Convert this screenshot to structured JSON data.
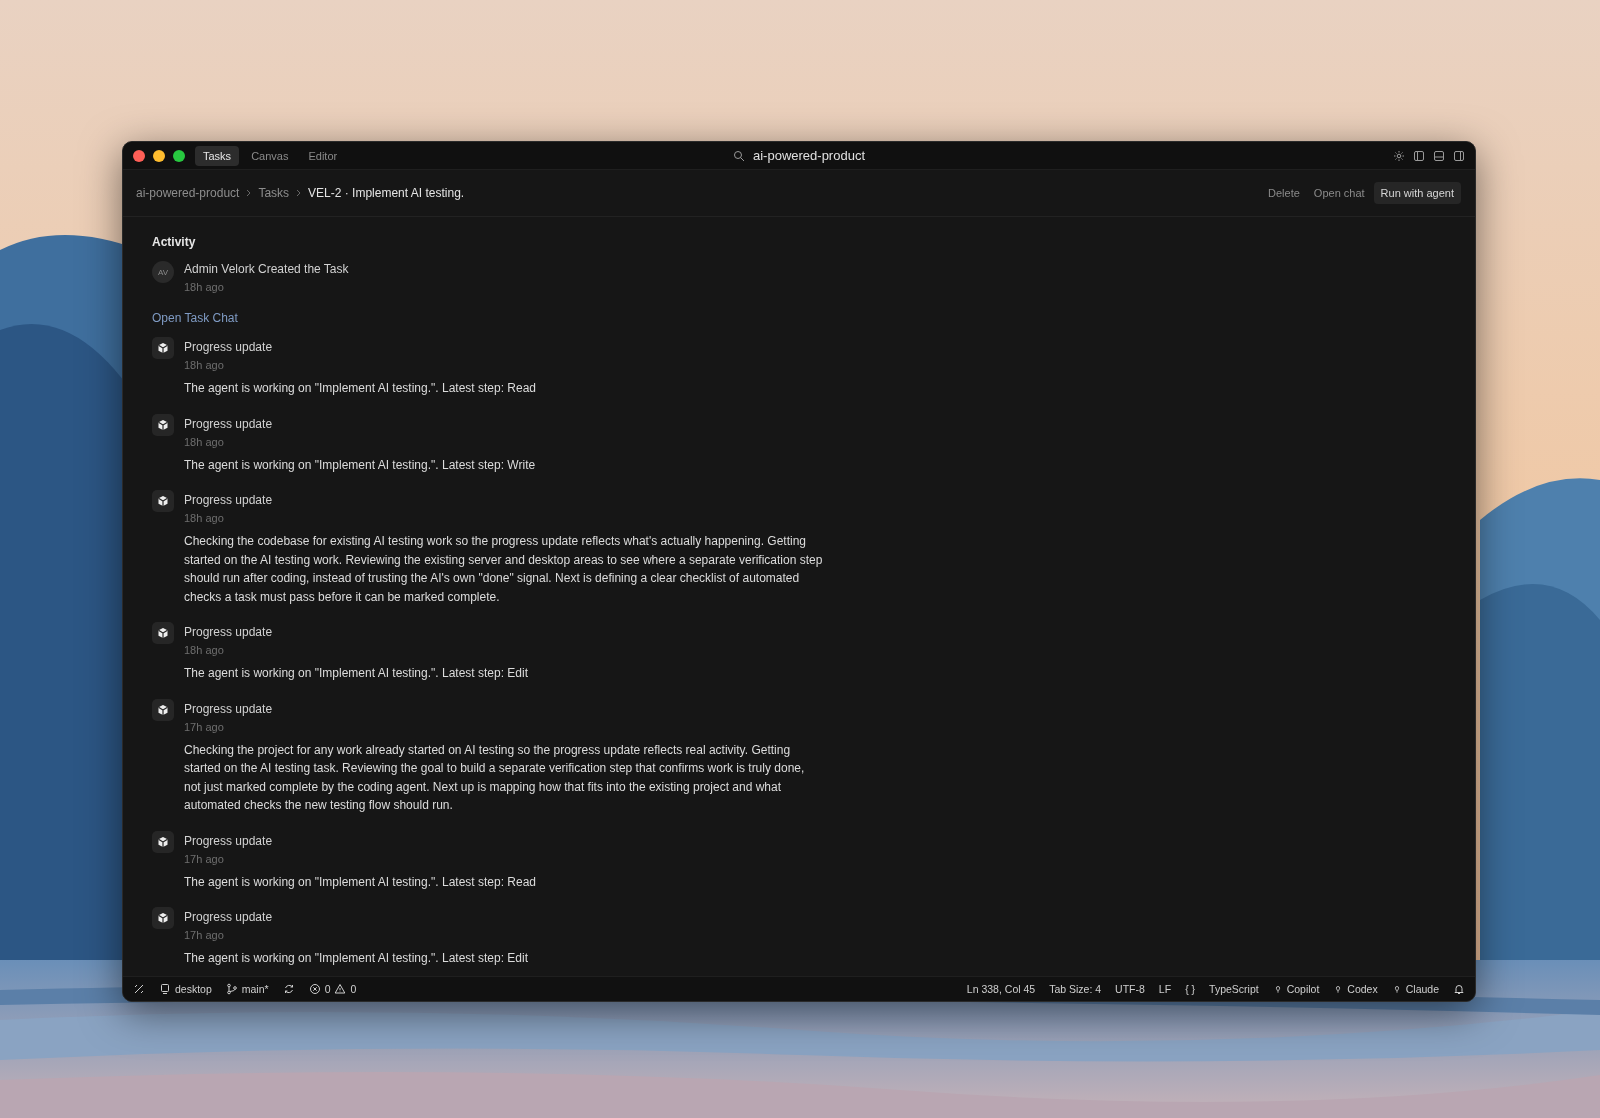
{
  "window": {
    "tabs": [
      {
        "label": "Tasks",
        "selected": true
      },
      {
        "label": "Canvas",
        "selected": false
      },
      {
        "label": "Editor",
        "selected": false
      }
    ],
    "search": {
      "value": "ai-powered-product"
    }
  },
  "breadcrumb": [
    "ai-powered-product",
    "Tasks",
    "VEL-2 · Implement AI testing."
  ],
  "actions": [
    {
      "label": "Delete",
      "kind": "plain"
    },
    {
      "label": "Open chat",
      "kind": "plain"
    },
    {
      "label": "Run with agent",
      "kind": "primary"
    }
  ],
  "activity": {
    "title": "Activity",
    "created": {
      "avatar": "AV",
      "text": "Admin Velork Created the Task",
      "time": "18h ago"
    },
    "link": "Open Task Chat",
    "updates": [
      {
        "title": "Progress update",
        "time": "18h ago",
        "text": "The agent is working on \"Implement AI testing.\". Latest step: Read"
      },
      {
        "title": "Progress update",
        "time": "18h ago",
        "text": "The agent is working on \"Implement AI testing.\". Latest step: Write"
      },
      {
        "title": "Progress update",
        "time": "18h ago",
        "text": "Checking the codebase for existing AI testing work so the progress update reflects what's actually happening. Getting started on the AI testing work. Reviewing the existing server and desktop areas to see where a separate verification step should run after coding, instead of trusting the AI's own \"done\" signal. Next is defining a clear checklist of automated checks a task must pass before it can be marked complete."
      },
      {
        "title": "Progress update",
        "time": "18h ago",
        "text": "The agent is working on \"Implement AI testing.\". Latest step: Edit"
      },
      {
        "title": "Progress update",
        "time": "17h ago",
        "text": "Checking the project for any work already started on AI testing so the progress update reflects real activity. Getting started on the AI testing task. Reviewing the goal to build a separate verification step that confirms work is truly done, not just marked complete by the coding agent. Next up is mapping how that fits into the existing project and what automated checks the new testing flow should run."
      },
      {
        "title": "Progress update",
        "time": "17h ago",
        "text": "The agent is working on \"Implement AI testing.\". Latest step: Read"
      },
      {
        "title": "Progress update",
        "time": "17h ago",
        "text": "The agent is working on \"Implement AI testing.\". Latest step: Edit"
      }
    ]
  },
  "status_bar": {
    "left": [
      {
        "kind": "remote"
      },
      {
        "kind": "workspace",
        "text": "desktop"
      },
      {
        "kind": "branch",
        "text": "main*"
      },
      {
        "kind": "sync"
      },
      {
        "kind": "problems",
        "errors": "0",
        "warnings": "0"
      }
    ],
    "right": [
      {
        "kind": "text",
        "text": "Ln 338, Col 45"
      },
      {
        "kind": "text",
        "text": "Tab Size: 4"
      },
      {
        "kind": "text",
        "text": "UTF-8"
      },
      {
        "kind": "text",
        "text": "LF"
      },
      {
        "kind": "text",
        "text": "{ }"
      },
      {
        "kind": "text",
        "text": "TypeScript"
      },
      {
        "kind": "agent",
        "text": "Copilot"
      },
      {
        "kind": "agent",
        "text": "Codex"
      },
      {
        "kind": "agent",
        "text": "Claude"
      },
      {
        "kind": "bell"
      }
    ]
  }
}
